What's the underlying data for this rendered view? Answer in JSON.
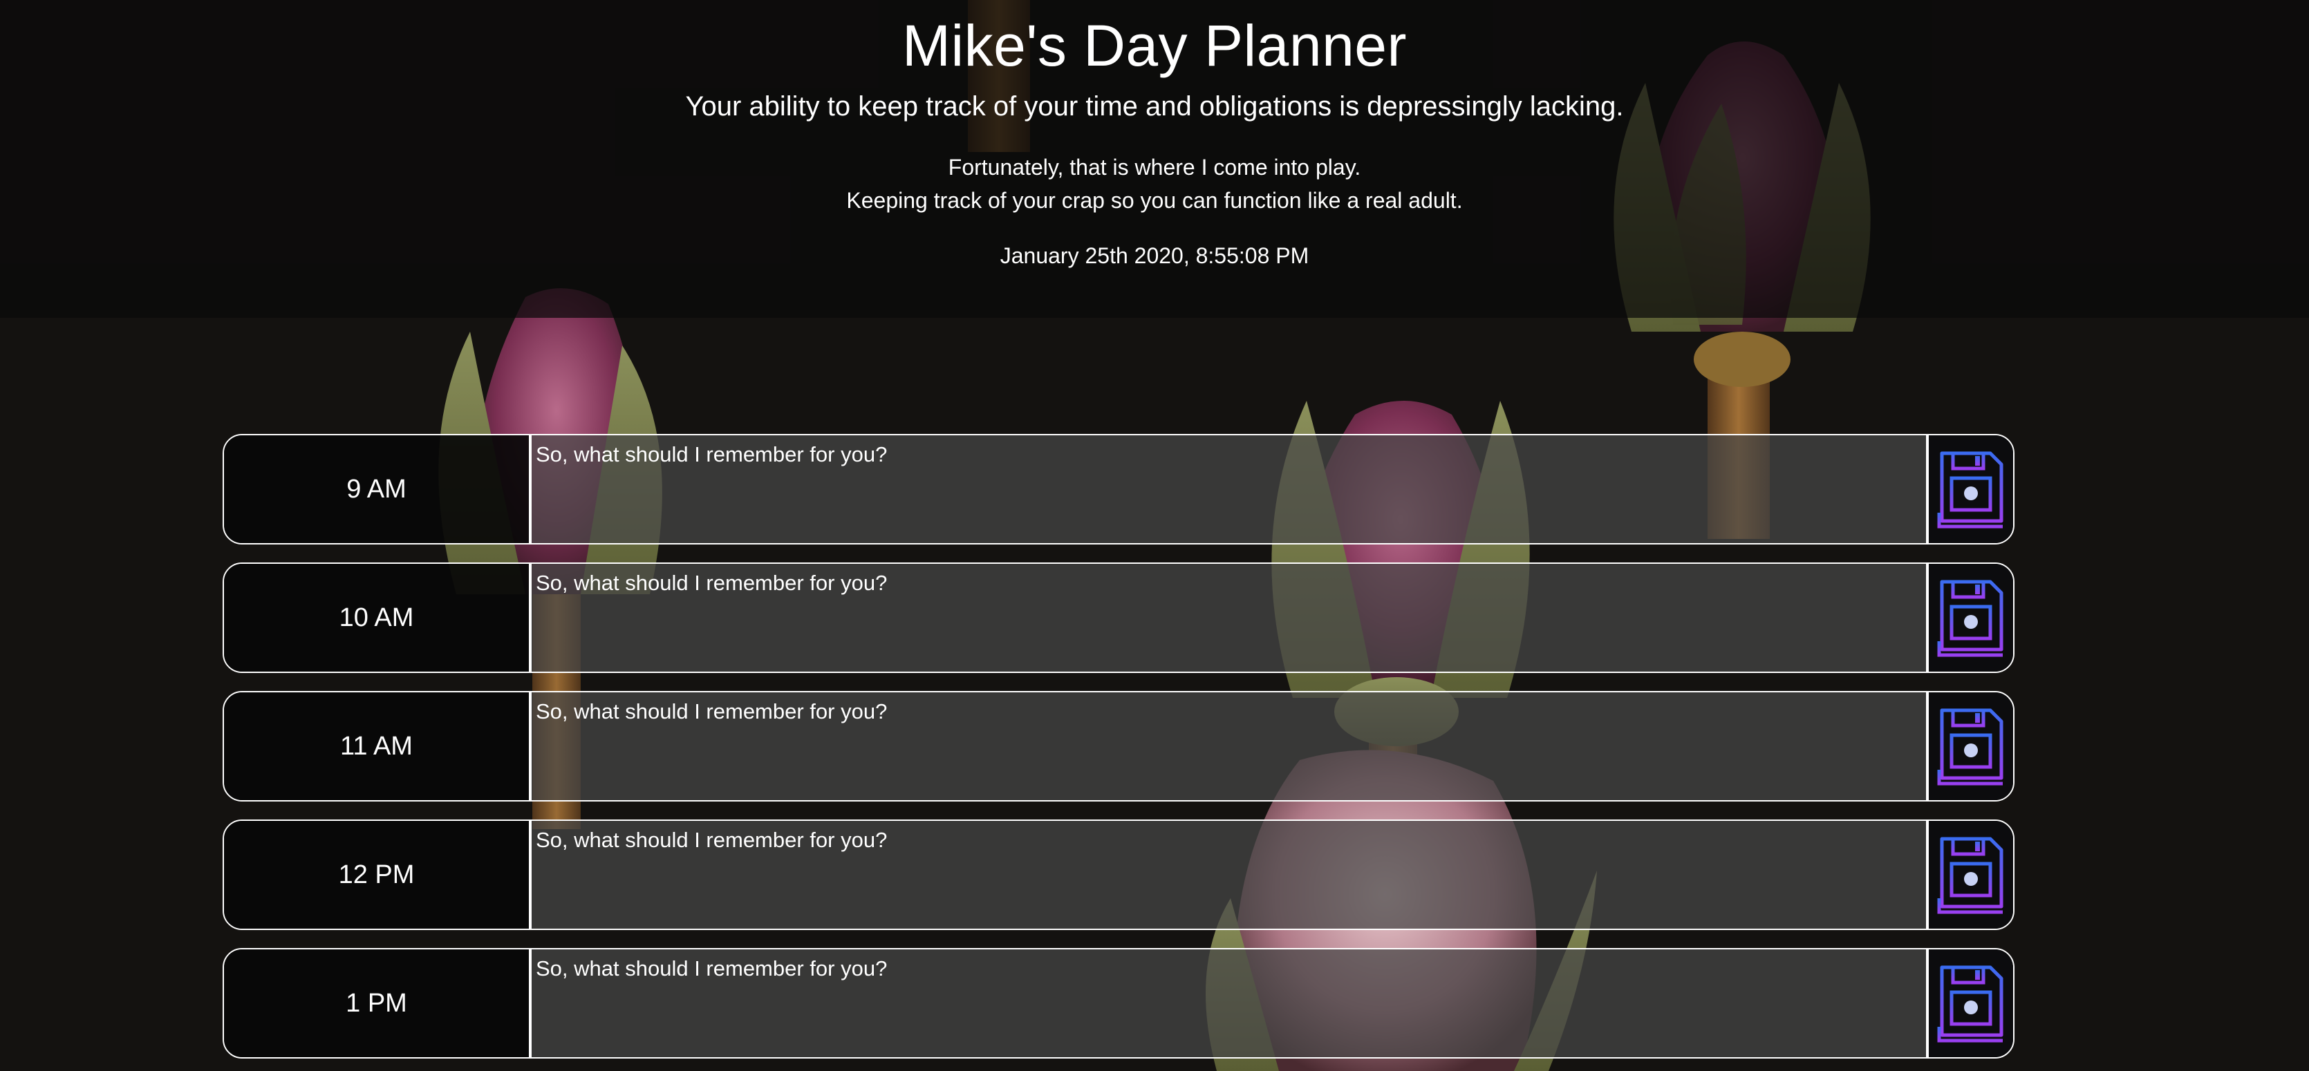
{
  "header": {
    "title": "Mike's Day Planner",
    "lead": "Your ability to keep track of your time and obligations is depressingly lacking.",
    "line1": "Fortunately, that is where I come into play.",
    "line2": "Keeping track of your crap so you can function like a real adult.",
    "current_datetime": "January 25th 2020, 8:55:08 PM"
  },
  "planner": {
    "rows": [
      {
        "hour": "9 AM",
        "placeholder": "So, what should I remember for you?",
        "value": ""
      },
      {
        "hour": "10 AM",
        "placeholder": "So, what should I remember for you?",
        "value": ""
      },
      {
        "hour": "11 AM",
        "placeholder": "So, what should I remember for you?",
        "value": ""
      },
      {
        "hour": "12 PM",
        "placeholder": "So, what should I remember for you?",
        "value": ""
      },
      {
        "hour": "1 PM",
        "placeholder": "So, what should I remember for you?",
        "value": ""
      }
    ],
    "save_icon": "floppy-disk-icon",
    "colors": {
      "save_icon_top": "#3a6cf0",
      "save_icon_bottom": "#9a3ff0",
      "row_border": "#ffffff"
    }
  },
  "background": {
    "subject": "dried-rose-buds"
  }
}
